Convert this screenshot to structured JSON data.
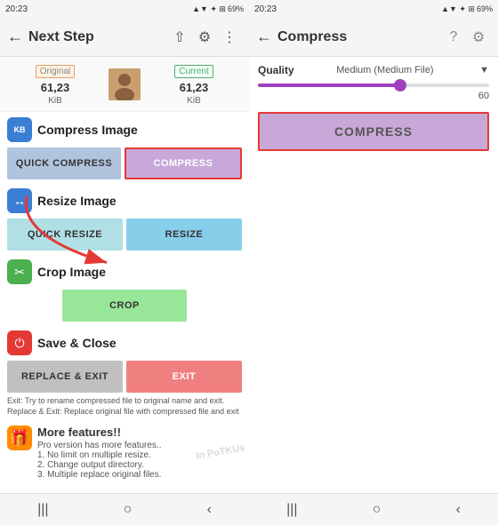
{
  "left_panel": {
    "status_bar": {
      "time": "20:23",
      "battery": "69%",
      "signal": "▲▼"
    },
    "top_bar": {
      "back_label": "←",
      "title": "Next Step",
      "share_icon": "share",
      "settings_icon": "⚙",
      "more_icon": "⋮"
    },
    "file_info": {
      "original_label": "Original",
      "original_size": "61,23",
      "original_unit": "KiB",
      "current_label": "Current",
      "current_size": "61,23",
      "current_unit": "KiB"
    },
    "sections": [
      {
        "id": "compress",
        "icon": "KB",
        "icon_class": "icon-blue",
        "title": "Compress Image",
        "buttons": [
          {
            "label": "QUICK COMPRESS",
            "class": "btn-quick-compress"
          },
          {
            "label": "COMPRESS",
            "class": "btn-compress",
            "highlight": true
          }
        ]
      },
      {
        "id": "resize",
        "icon": "↔",
        "icon_class": "icon-blue",
        "title": "Resize Image",
        "buttons": [
          {
            "label": "QUICK RESIZE",
            "class": "btn-quick-resize"
          },
          {
            "label": "RESIZE",
            "class": "btn-resize"
          }
        ]
      },
      {
        "id": "crop",
        "icon": "✂",
        "icon_class": "icon-green",
        "title": "Crop Image",
        "buttons": [
          {
            "label": "CROP",
            "class": "btn-crop",
            "single": true
          }
        ]
      },
      {
        "id": "save",
        "icon": "⏻",
        "icon_class": "icon-red",
        "title": "Save & Close",
        "buttons": [
          {
            "label": "REPLACE & EXIT",
            "class": "btn-replace"
          },
          {
            "label": "EXIT",
            "class": "btn-exit"
          }
        ],
        "note": "Exit: Try to rename compressed file to original name and exit. Replace & Exit: Replace original file with compressed file and exit"
      }
    ],
    "more_features": {
      "icon": "🎁",
      "icon_class": "icon-orange",
      "title": "More features!!",
      "items": [
        "Pro version has more features..",
        "1. No limit on multiple resize.",
        "2. Change output directory.",
        "3. Multiple replace original files."
      ]
    },
    "nav_bar": {
      "left_icon": "|||",
      "center_icon": "○",
      "right_icon": "‹"
    }
  },
  "right_panel": {
    "status_bar": {
      "time": "20:23",
      "battery": "69%"
    },
    "top_bar": {
      "back_label": "←",
      "title": "Compress",
      "question_icon": "?",
      "settings_icon": "⚙"
    },
    "quality": {
      "label": "Quality",
      "value": "Medium (Medium File)",
      "dropdown": "▼"
    },
    "slider": {
      "value": "60",
      "fill_percent": 60
    },
    "compress_button": "COMPRESS",
    "nav_bar": {
      "left_icon": "|||",
      "center_icon": "○",
      "right_icon": "‹"
    }
  }
}
